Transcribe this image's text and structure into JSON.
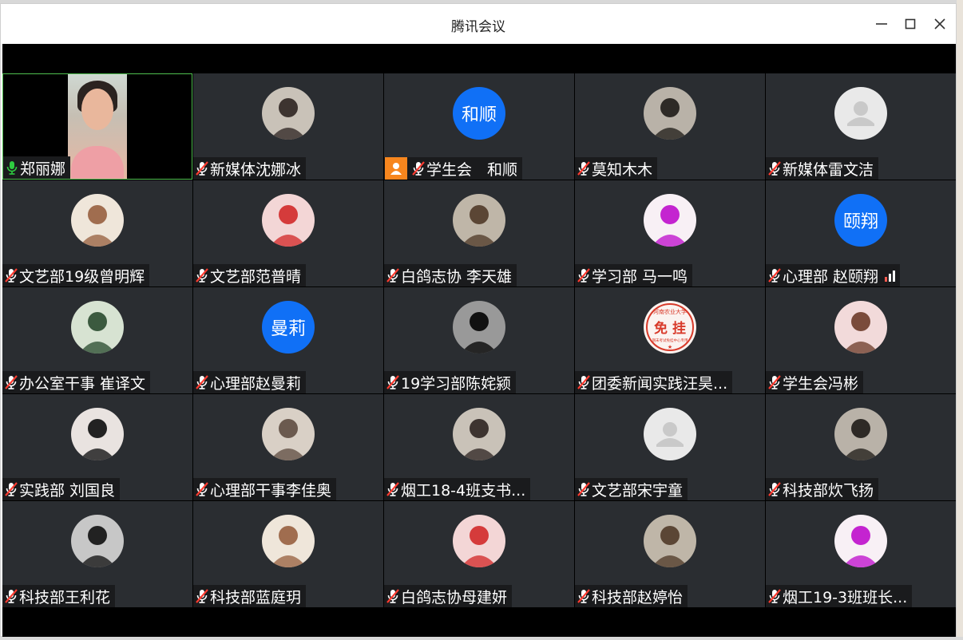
{
  "window": {
    "title": "腾讯会议"
  },
  "colors": {
    "active_border": "#4fbf4f",
    "tile_bg": "#2a2d31",
    "text_avatar_bg": "#1070f6",
    "host_badge": "#f7861e",
    "mic_muted": "#ff3b30",
    "mic_on": "#2ecc40"
  },
  "participants": [
    {
      "name": "郑丽娜",
      "mic": "on",
      "avatar": "video"
    },
    {
      "name": "新媒体沈娜冰",
      "mic": "muted",
      "avatar": "photo"
    },
    {
      "name": "学生会　和顺",
      "mic": "muted",
      "avatar": "text",
      "avatar_text": "和顺",
      "host": true
    },
    {
      "name": "莫知木木",
      "mic": "muted",
      "avatar": "photo"
    },
    {
      "name": "新媒体雷文洁",
      "mic": "muted",
      "avatar": "default"
    },
    {
      "name": "文艺部19级曾明辉",
      "mic": "muted",
      "avatar": "photo"
    },
    {
      "name": "文艺部范普晴",
      "mic": "muted",
      "avatar": "photo"
    },
    {
      "name": "白鸽志协  李天雄",
      "mic": "muted",
      "avatar": "photo"
    },
    {
      "name": "学习部 马一鸣",
      "mic": "muted",
      "avatar": "photo"
    },
    {
      "name": "心理部 赵颐翔",
      "mic": "muted",
      "avatar": "text",
      "avatar_text": "颐翔",
      "signal": true
    },
    {
      "name": "办公室干事 崔译文",
      "mic": "muted",
      "avatar": "photo"
    },
    {
      "name": "心理部赵曼莉",
      "mic": "muted",
      "avatar": "text",
      "avatar_text": "曼莉"
    },
    {
      "name": "19学习部陈姹颍",
      "mic": "muted",
      "avatar": "photo"
    },
    {
      "name": "团委新闻实践汪昊...",
      "mic": "muted",
      "avatar": "stamp",
      "stamp_top": "河南农业大学",
      "stamp_main": "免 挂",
      "stamp_bottom": "期末考试免挂中心专用"
    },
    {
      "name": "学生会冯彬",
      "mic": "muted",
      "avatar": "photo"
    },
    {
      "name": "实践部 刘国良",
      "mic": "muted",
      "avatar": "photo"
    },
    {
      "name": "心理部干事李佳奥",
      "mic": "muted",
      "avatar": "photo"
    },
    {
      "name": "烟工18-4班支书...",
      "mic": "muted",
      "avatar": "photo"
    },
    {
      "name": "文艺部宋宇童",
      "mic": "muted",
      "avatar": "default"
    },
    {
      "name": "科技部炊飞扬",
      "mic": "muted",
      "avatar": "photo"
    },
    {
      "name": "科技部王利花",
      "mic": "muted",
      "avatar": "photo"
    },
    {
      "name": "科技部蓝庭玥",
      "mic": "muted",
      "avatar": "photo"
    },
    {
      "name": "白鸽志协母建妍",
      "mic": "muted",
      "avatar": "photo"
    },
    {
      "name": "科技部赵婷怡",
      "mic": "muted",
      "avatar": "photo"
    },
    {
      "name": "烟工19-3班班长...",
      "mic": "muted",
      "avatar": "photo"
    }
  ]
}
